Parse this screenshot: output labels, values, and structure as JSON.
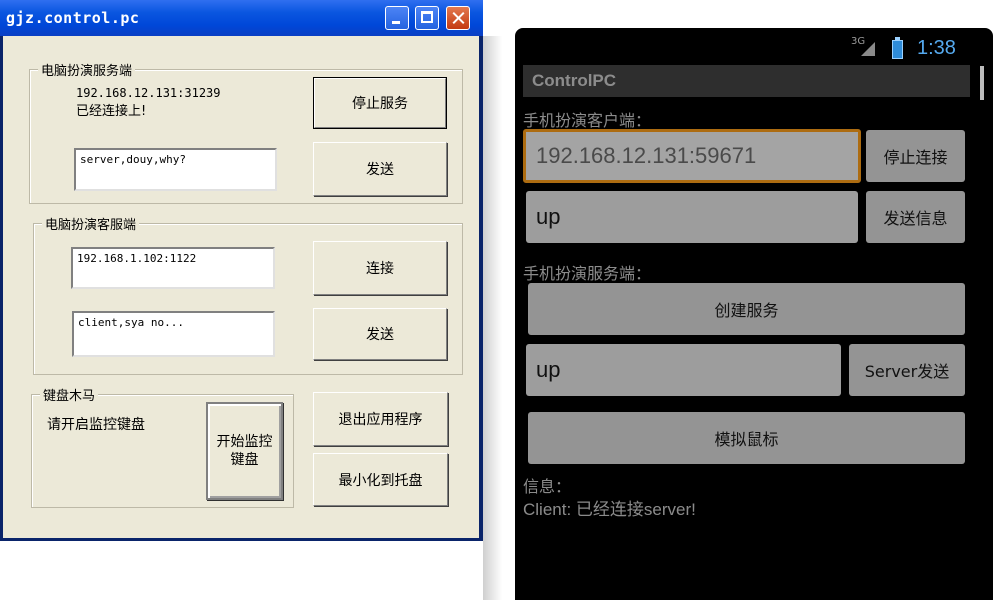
{
  "pc_window": {
    "title": "gjz.control.pc",
    "server_group": {
      "label": "电脑扮演服务端",
      "address": "192.168.12.131:31239",
      "status": "已经连接上!",
      "message_value": "server,douy,why?",
      "stop_button": "停止服务",
      "send_button": "发送"
    },
    "client_group": {
      "label": "电脑扮演客服端",
      "address_value": "192.168.1.102:1122",
      "connect_button": "连接",
      "message_value": "client,sya no...",
      "send_button": "发送"
    },
    "keyboard_group": {
      "label": "键盘木马",
      "hint": "请开启监控键盘",
      "start_button": "开始监控键盘"
    },
    "exit_button": "退出应用程序",
    "minimize_tray_button": "最小化到托盘"
  },
  "phone": {
    "status_bar": {
      "network": "3G",
      "time": "1:38"
    },
    "app_title": "ControlPC",
    "client_section_label": "手机扮演客户端：",
    "client_address_value": "192.168.12.131:59671",
    "stop_connect_button": "停止连接",
    "client_message_value": "up",
    "send_info_button": "发送信息",
    "server_section_label": "手机扮演服务端：",
    "create_service_button": "创建服务",
    "server_message_value": "up",
    "server_send_button": "Server发送",
    "simulate_mouse_button": "模拟鼠标",
    "info_label": "信息：",
    "info_text": "Client: 已经连接server!"
  },
  "colors": {
    "xp_titlebar": "#0a56e0",
    "xp_face": "#ece9d8",
    "android_focus": "#ff9f1a",
    "android_clock": "#55a9ee"
  }
}
